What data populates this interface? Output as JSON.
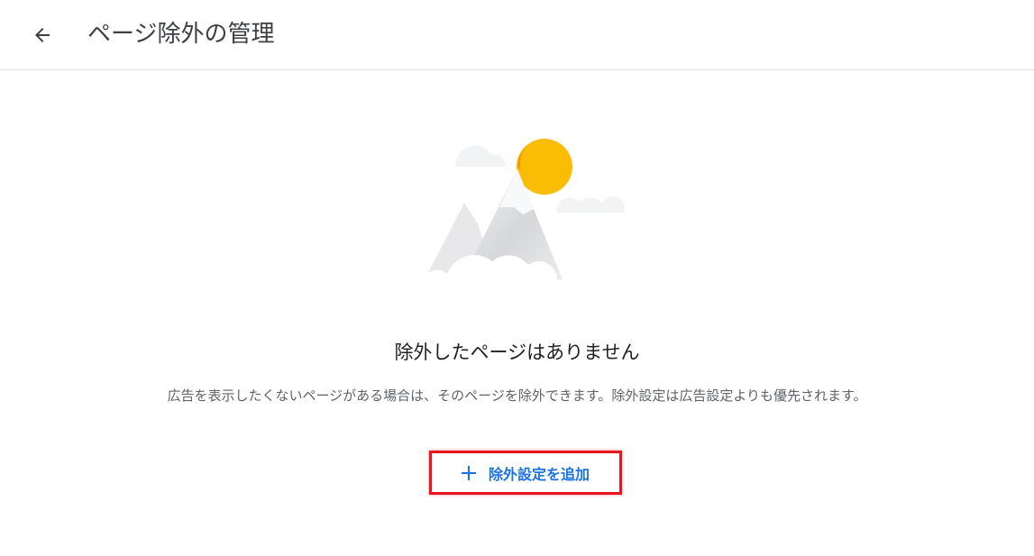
{
  "header": {
    "back_icon": "arrow-back-icon",
    "title": "ページ除外の管理"
  },
  "empty_state": {
    "illustration": "mountain-sun-clouds-illustration",
    "title": "除外したページはありません",
    "description": "広告を表示したくないページがある場合は、そのページを除外できます。除外設定は広告設定よりも優先されます。"
  },
  "actions": {
    "add_icon": "plus-icon",
    "add_label": "除外設定を追加"
  },
  "colors": {
    "accent": "#1a73e8",
    "highlight_border": "#e8141e",
    "sun": "#fbbc04"
  }
}
